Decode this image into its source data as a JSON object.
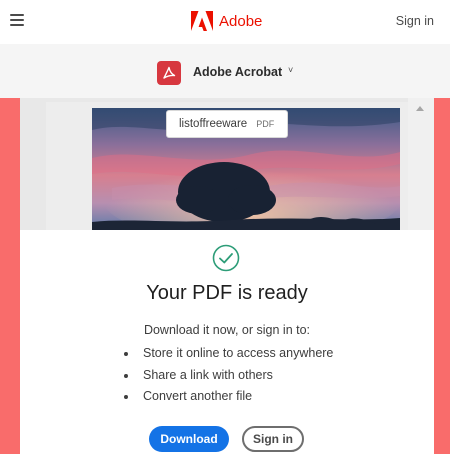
{
  "header": {
    "brand_name": "Adobe",
    "sign_in_label": "Sign in",
    "brand_color": "#eb1000"
  },
  "product": {
    "name": "Adobe Acrobat",
    "chevron": "˅"
  },
  "preview": {
    "file_name": "listoffreeware",
    "file_ext": "PDF"
  },
  "result": {
    "title": "Your PDF is ready",
    "intro": "Download it now, or sign in to:",
    "bullets": [
      "Store it online to access anywhere",
      "Share a link with others",
      "Convert another file"
    ],
    "download_label": "Download",
    "sign_in_label": "Sign in"
  },
  "colors": {
    "accent_blue": "#1473e6",
    "backdrop": "#f96c6b",
    "success_green": "#2d9d78"
  }
}
